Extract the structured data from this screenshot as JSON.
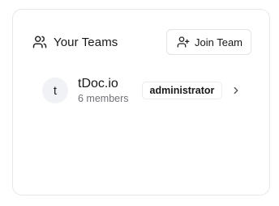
{
  "header": {
    "title": "Your Teams",
    "users_icon": "users-icon",
    "join_button_label": "Join Team",
    "join_icon": "user-plus-icon"
  },
  "teams": [
    {
      "avatar_letter": "t",
      "name": "tDoc.io",
      "members": "6 members",
      "role": "administrator",
      "chevron_icon": "chevron-right-icon"
    }
  ],
  "colors": {
    "border": "#e8e8ea",
    "text": "#18181b",
    "muted": "#71717a",
    "avatar_bg": "#f1f2f5"
  }
}
